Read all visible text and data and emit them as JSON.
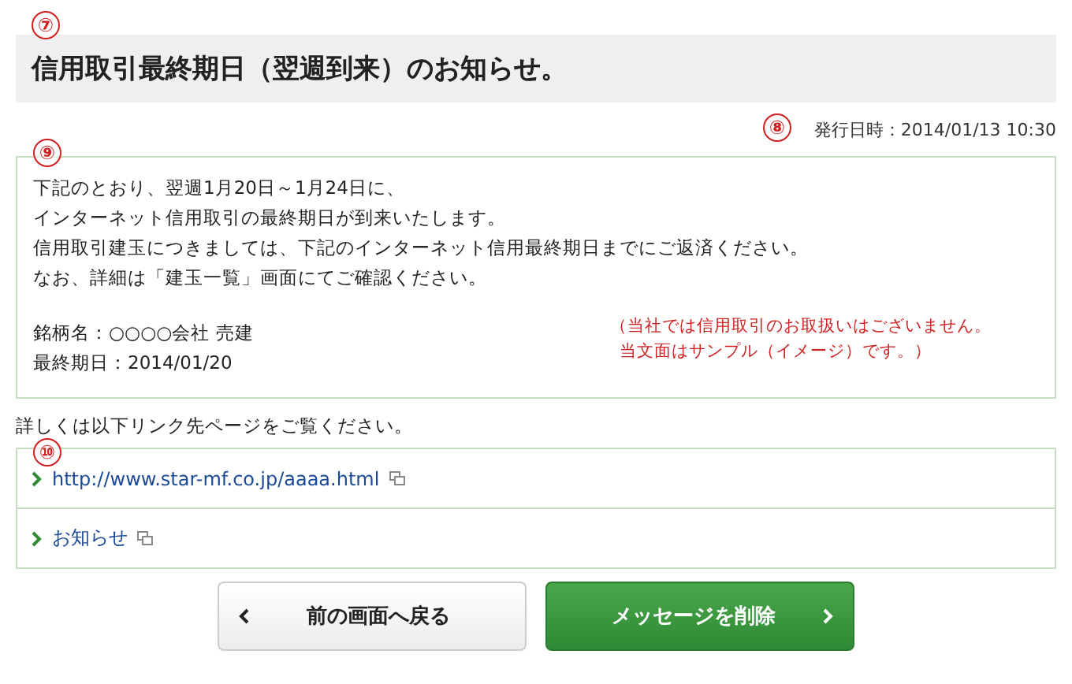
{
  "title": {
    "text": "信用取引最終期日（翌週到来）のお知らせ。",
    "callout": "⑦"
  },
  "issued": {
    "text": "発行日時：2014/01/13 10:30",
    "callout": "⑧"
  },
  "message": {
    "callout": "⑨",
    "paragraph": [
      "下記のとおり、翌週1月20日～1月24日に、",
      "インターネット信用取引の最終期日が到来いたします。",
      "信用取引建玉につきましては、下記のインターネット信用最終期日までにご返済ください。",
      "なお、詳細は「建玉一覧」画面にてご確認ください。"
    ],
    "details": [
      "銘柄名：○○○○会社 売建",
      "最終期日：2014/01/20"
    ],
    "notes": [
      "（当社では信用取引のお取扱いはございません。",
      "当文面はサンプル（イメージ）です。）"
    ]
  },
  "links_intro": "詳しくは以下リンク先ページをご覧ください。",
  "links": {
    "callout": "⑩",
    "items": [
      {
        "label": "http://www.star-mf.co.jp/aaaa.html"
      },
      {
        "label": "お知らせ"
      }
    ]
  },
  "buttons": [
    {
      "kind": "back",
      "label": "前の画面へ戻る"
    },
    {
      "kind": "primary",
      "label": "メッセージを削除"
    }
  ]
}
